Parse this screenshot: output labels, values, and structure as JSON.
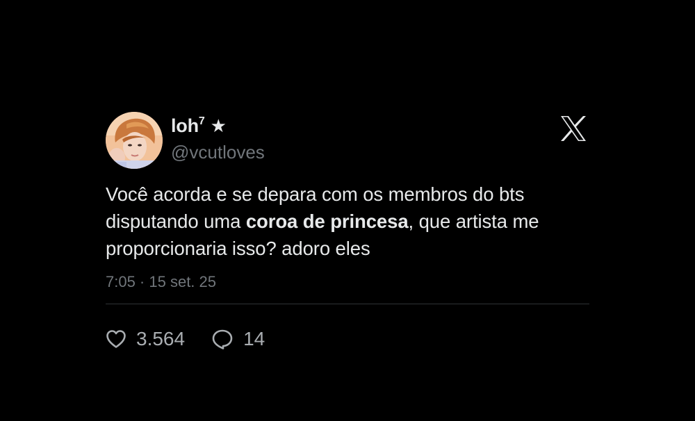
{
  "tweet": {
    "display_name": "loh",
    "display_name_sup": "7",
    "handle": "@vcutloves",
    "text": {
      "part1": "Você acorda e se depara com os membros do bts disputando uma ",
      "bold": "coroa de princesa",
      "part2": ", que artista me proporcionaria isso? adoro eles"
    },
    "timestamp": "7:05 · 15 set. 25",
    "likes": "3.564",
    "replies": "14"
  },
  "icons": {
    "badge": "star-icon",
    "platform": "x-logo-icon",
    "like": "heart-icon",
    "reply": "comment-icon"
  },
  "colors": {
    "background": "#000000",
    "text_primary": "#e7e9ea",
    "text_secondary": "#71767b",
    "divider": "#2f3336"
  }
}
